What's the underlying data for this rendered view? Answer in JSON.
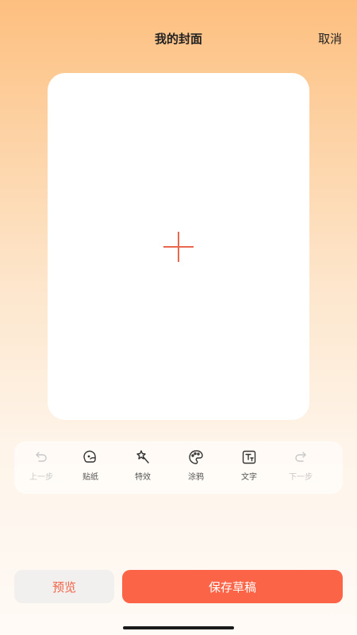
{
  "header": {
    "title": "我的封面",
    "cancel_label": "取消"
  },
  "canvas": {
    "add_icon": "plus-icon",
    "accent_color": "#e8674e"
  },
  "toolbar": {
    "items": [
      {
        "label": "上一步",
        "icon": "undo-icon",
        "enabled": false
      },
      {
        "label": "贴纸",
        "icon": "sticker-icon",
        "enabled": true
      },
      {
        "label": "特效",
        "icon": "magic-wand-icon",
        "enabled": true
      },
      {
        "label": "涂鸦",
        "icon": "palette-icon",
        "enabled": true
      },
      {
        "label": "文字",
        "icon": "text-icon",
        "enabled": true
      },
      {
        "label": "下一步",
        "icon": "redo-icon",
        "enabled": false
      }
    ]
  },
  "footer": {
    "preview_label": "预览",
    "save_label": "保存草稿"
  },
  "colors": {
    "primary": "#fb6446",
    "preview_bg": "#f2f0ee",
    "preview_text": "#f06347"
  }
}
